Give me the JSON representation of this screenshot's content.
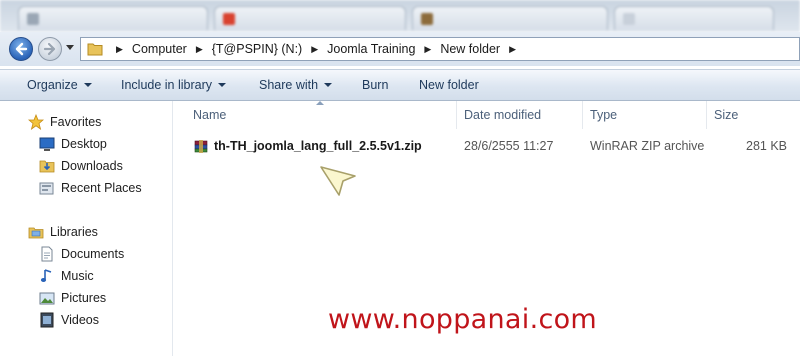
{
  "address_bar": {
    "crumbs": [
      "Computer",
      "{T@PSPIN} (N:)",
      "Joomla Training",
      "New folder"
    ]
  },
  "command_bar": {
    "organize": "Organize",
    "include_in_library": "Include in library",
    "share_with": "Share with",
    "burn": "Burn",
    "new_folder": "New folder"
  },
  "nav_pane": {
    "favorites": {
      "title": "Favorites",
      "items": [
        "Desktop",
        "Downloads",
        "Recent Places"
      ]
    },
    "libraries": {
      "title": "Libraries",
      "items": [
        "Documents",
        "Music",
        "Pictures",
        "Videos"
      ]
    }
  },
  "columns": {
    "name": "Name",
    "date_modified": "Date modified",
    "type": "Type",
    "size": "Size"
  },
  "files": [
    {
      "name": "th-TH_joomla_lang_full_2.5.5v1.zip",
      "date_modified": "28/6/2555 11:27",
      "type": "WinRAR ZIP archive",
      "size": "281 KB",
      "icon": "winrar-archive-icon"
    }
  ],
  "watermark": "www.noppanai.com",
  "colors": {
    "watermark": "#c0141a",
    "link_text": "#1e395b",
    "column_header_text": "#4c607a"
  }
}
